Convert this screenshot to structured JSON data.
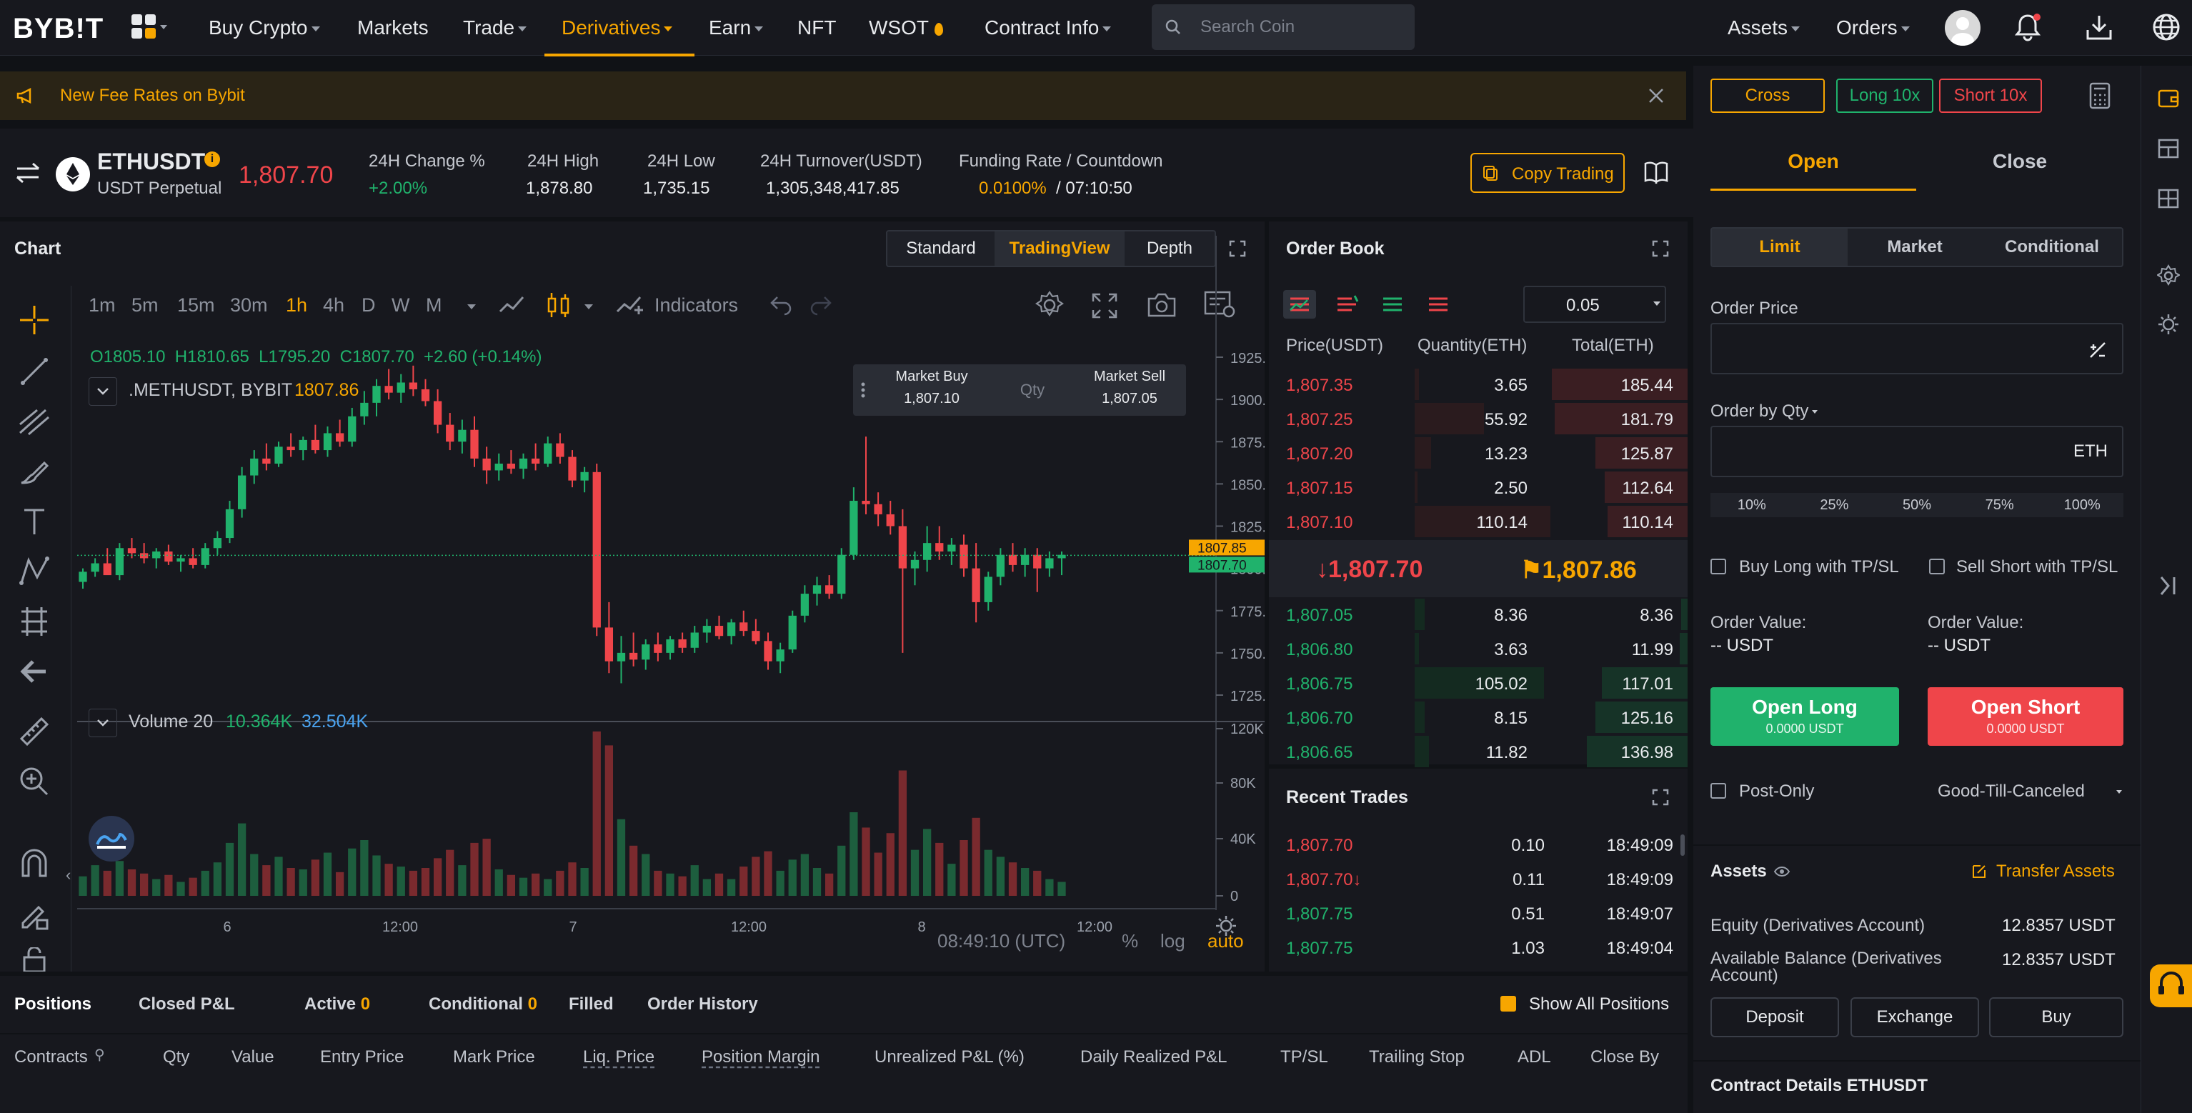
{
  "nav": {
    "logo": "BYB!T",
    "items": [
      {
        "label": "Buy Crypto",
        "caret": true
      },
      {
        "label": "Markets",
        "caret": false
      },
      {
        "label": "Trade",
        "caret": true
      },
      {
        "label": "Derivatives",
        "caret": true,
        "active": true
      },
      {
        "label": "Earn",
        "caret": true
      },
      {
        "label": "NFT",
        "caret": false
      },
      {
        "label": "WSOT",
        "caret": false
      },
      {
        "label": "Contract Info",
        "caret": true
      }
    ],
    "search_placeholder": "Search Coin",
    "assets": "Assets",
    "orders": "Orders"
  },
  "banner": {
    "text": "New Fee Rates on Bybit"
  },
  "ticker": {
    "symbol": "ETHUSDT",
    "subtitle": "USDT Perpetual",
    "price": "1,807.70",
    "change_label": "24H Change %",
    "change": "+2.00%",
    "high_label": "24H High",
    "high": "1,878.80",
    "low_label": "24H Low",
    "low": "1,735.15",
    "turnover_label": "24H Turnover(USDT)",
    "turnover": "1,305,348,417.85",
    "funding_label": "Funding Rate / Countdown",
    "funding_rate": "0.0100%",
    "countdown": "/ 07:10:50",
    "copy_trading": "Copy Trading"
  },
  "chart_panel": {
    "title": "Chart",
    "view_tabs": [
      "Standard",
      "TradingView",
      "Depth"
    ],
    "active_view": "TradingView",
    "timeframes": [
      "1m",
      "5m",
      "15m",
      "30m",
      "1h",
      "4h",
      "D",
      "W",
      "M"
    ],
    "active_timeframe": "1h",
    "indicators": "Indicators",
    "ohlc": "O1805.10  H1810.65  L1795.20  C1807.70  +2.60 (+0.14%)",
    "series_label": ".METHUSDT, BYBIT",
    "series_value": "1807.86",
    "market_buy_label": "Market Buy",
    "market_buy_price": "1,807.10",
    "qty_label": "Qty",
    "market_sell_label": "Market Sell",
    "market_sell_price": "1,807.05",
    "volume_label": "Volume 20",
    "volume_v1": "10.364K",
    "volume_v2": "32.504K",
    "time_display": "08:49:10 (UTC)",
    "scale_opts": [
      "%",
      "log",
      "auto"
    ]
  },
  "chart_data": {
    "type": "candlestick",
    "x_ticks": [
      "6",
      "12:00",
      "7",
      "12:00",
      "8",
      "12:00"
    ],
    "y_ticks": [
      "1925.00",
      "1900.00",
      "1875.00",
      "1850.00",
      "1825.00",
      "1800.00",
      "1775.00",
      "1750.00",
      "1725.00"
    ],
    "ylim": [
      1718,
      1930
    ],
    "price_labels": [
      "1807.85",
      "1807.70"
    ],
    "volume_ticks": [
      "120K",
      "80K",
      "40K",
      "0"
    ],
    "volume_ylim": [
      0,
      120
    ],
    "candles": [
      [
        1792,
        1800,
        1788,
        1798,
        14
      ],
      [
        1798,
        1806,
        1795,
        1803,
        22
      ],
      [
        1803,
        1812,
        1800,
        1796,
        18
      ],
      [
        1796,
        1815,
        1793,
        1812,
        25
      ],
      [
        1812,
        1818,
        1806,
        1809,
        19
      ],
      [
        1809,
        1815,
        1803,
        1806,
        16
      ],
      [
        1806,
        1812,
        1800,
        1810,
        12
      ],
      [
        1810,
        1814,
        1802,
        1804,
        15
      ],
      [
        1804,
        1808,
        1798,
        1806,
        10
      ],
      [
        1806,
        1812,
        1800,
        1802,
        13
      ],
      [
        1802,
        1815,
        1800,
        1812,
        18
      ],
      [
        1812,
        1822,
        1808,
        1818,
        24
      ],
      [
        1818,
        1840,
        1815,
        1835,
        38
      ],
      [
        1835,
        1860,
        1830,
        1855,
        52
      ],
      [
        1855,
        1870,
        1850,
        1865,
        30
      ],
      [
        1865,
        1874,
        1858,
        1862,
        22
      ],
      [
        1862,
        1875,
        1860,
        1872,
        28
      ],
      [
        1872,
        1880,
        1866,
        1870,
        20
      ],
      [
        1870,
        1878,
        1864,
        1876,
        19
      ],
      [
        1876,
        1885,
        1868,
        1870,
        26
      ],
      [
        1870,
        1884,
        1866,
        1880,
        31
      ],
      [
        1880,
        1888,
        1872,
        1875,
        17
      ],
      [
        1875,
        1895,
        1872,
        1890,
        34
      ],
      [
        1890,
        1905,
        1885,
        1898,
        40
      ],
      [
        1898,
        1912,
        1890,
        1908,
        29
      ],
      [
        1908,
        1918,
        1900,
        1904,
        23
      ],
      [
        1904,
        1915,
        1898,
        1910,
        21
      ],
      [
        1910,
        1920,
        1902,
        1906,
        18
      ],
      [
        1906,
        1912,
        1896,
        1899,
        20
      ],
      [
        1899,
        1906,
        1880,
        1885,
        27
      ],
      [
        1885,
        1892,
        1870,
        1875,
        33
      ],
      [
        1875,
        1888,
        1868,
        1882,
        22
      ],
      [
        1882,
        1890,
        1860,
        1865,
        38
      ],
      [
        1865,
        1872,
        1850,
        1858,
        41
      ],
      [
        1858,
        1868,
        1852,
        1862,
        19
      ],
      [
        1862,
        1870,
        1856,
        1859,
        15
      ],
      [
        1859,
        1868,
        1853,
        1865,
        13
      ],
      [
        1865,
        1874,
        1858,
        1862,
        16
      ],
      [
        1862,
        1878,
        1860,
        1874,
        12
      ],
      [
        1874,
        1880,
        1862,
        1866,
        18
      ],
      [
        1866,
        1870,
        1848,
        1852,
        24
      ],
      [
        1852,
        1860,
        1845,
        1857,
        20
      ],
      [
        1857,
        1862,
        1760,
        1765,
        118
      ],
      [
        1765,
        1780,
        1738,
        1745,
        108
      ],
      [
        1745,
        1760,
        1732,
        1750,
        55
      ],
      [
        1750,
        1762,
        1742,
        1746,
        36
      ],
      [
        1746,
        1758,
        1740,
        1755,
        30
      ],
      [
        1755,
        1762,
        1745,
        1750,
        18
      ],
      [
        1750,
        1760,
        1746,
        1758,
        16
      ],
      [
        1758,
        1762,
        1750,
        1753,
        14
      ],
      [
        1753,
        1766,
        1750,
        1762,
        22
      ],
      [
        1762,
        1770,
        1756,
        1766,
        12
      ],
      [
        1766,
        1772,
        1758,
        1760,
        16
      ],
      [
        1760,
        1770,
        1755,
        1768,
        12
      ],
      [
        1768,
        1775,
        1760,
        1763,
        21
      ],
      [
        1763,
        1770,
        1755,
        1757,
        28
      ],
      [
        1757,
        1762,
        1740,
        1745,
        32
      ],
      [
        1745,
        1756,
        1738,
        1752,
        18
      ],
      [
        1752,
        1775,
        1750,
        1772,
        26
      ],
      [
        1772,
        1790,
        1768,
        1785,
        30
      ],
      [
        1785,
        1795,
        1778,
        1790,
        20
      ],
      [
        1790,
        1796,
        1782,
        1785,
        16
      ],
      [
        1785,
        1812,
        1782,
        1808,
        36
      ],
      [
        1808,
        1848,
        1805,
        1840,
        60
      ],
      [
        1840,
        1878,
        1832,
        1838,
        49
      ],
      [
        1838,
        1845,
        1825,
        1832,
        31
      ],
      [
        1832,
        1840,
        1820,
        1825,
        45
      ],
      [
        1825,
        1835,
        1750,
        1800,
        90
      ],
      [
        1800,
        1810,
        1790,
        1805,
        33
      ],
      [
        1805,
        1825,
        1798,
        1815,
        48
      ],
      [
        1815,
        1825,
        1805,
        1810,
        38
      ],
      [
        1810,
        1818,
        1802,
        1814,
        23
      ],
      [
        1814,
        1820,
        1795,
        1800,
        40
      ],
      [
        1800,
        1815,
        1768,
        1780,
        56
      ],
      [
        1780,
        1798,
        1775,
        1795,
        33
      ],
      [
        1795,
        1812,
        1790,
        1808,
        28
      ],
      [
        1808,
        1815,
        1798,
        1802,
        24
      ],
      [
        1802,
        1812,
        1795,
        1808,
        20
      ],
      [
        1808,
        1812,
        1786,
        1800,
        18
      ],
      [
        1800,
        1810,
        1795,
        1806,
        12
      ],
      [
        1806,
        1810,
        1796,
        1808,
        10
      ]
    ]
  },
  "orderbook": {
    "title": "Order Book",
    "precision": "0.05",
    "headers": [
      "Price(USDT)",
      "Quantity(ETH)",
      "Total(ETH)"
    ],
    "asks": [
      {
        "price": "1,807.35",
        "qty": "3.65",
        "total": "185.44",
        "depth": 1.0
      },
      {
        "price": "1,807.25",
        "qty": "55.92",
        "total": "181.79",
        "depth": 0.98
      },
      {
        "price": "1,807.20",
        "qty": "13.23",
        "total": "125.87",
        "depth": 0.68
      },
      {
        "price": "1,807.15",
        "qty": "2.50",
        "total": "112.64",
        "depth": 0.61
      },
      {
        "price": "1,807.10",
        "qty": "110.14",
        "total": "110.14",
        "depth": 0.59
      }
    ],
    "last_price": "1,807.70",
    "mark_price": "1,807.86",
    "bids": [
      {
        "price": "1,807.05",
        "qty": "8.36",
        "total": "8.36",
        "depth": 0.05
      },
      {
        "price": "1,806.80",
        "qty": "3.63",
        "total": "11.99",
        "depth": 0.06
      },
      {
        "price": "1,806.75",
        "qty": "105.02",
        "total": "117.01",
        "depth": 0.63
      },
      {
        "price": "1,806.70",
        "qty": "8.15",
        "total": "125.16",
        "depth": 0.68
      },
      {
        "price": "1,806.65",
        "qty": "11.82",
        "total": "136.98",
        "depth": 0.74
      }
    ]
  },
  "recent_trades": {
    "title": "Recent Trades",
    "rows": [
      {
        "price": "1,807.70",
        "qty": "0.10",
        "time": "18:49:09",
        "side": "sell",
        "arrow": ""
      },
      {
        "price": "1,807.70",
        "qty": "0.11",
        "time": "18:49:09",
        "side": "sell",
        "arrow": "↓"
      },
      {
        "price": "1,807.75",
        "qty": "0.51",
        "time": "18:49:07",
        "side": "buy",
        "arrow": ""
      },
      {
        "price": "1,807.75",
        "qty": "1.03",
        "time": "18:49:04",
        "side": "buy",
        "arrow": ""
      }
    ]
  },
  "order_form": {
    "margin_mode": "Cross",
    "long_lev": "Long 10x",
    "short_lev": "Short 10x",
    "tabs": [
      "Open",
      "Close"
    ],
    "types": [
      "Limit",
      "Market",
      "Conditional"
    ],
    "price_label": "Order Price",
    "qty_label": "Order by Qty",
    "qty_unit": "ETH",
    "pcts": [
      "10%",
      "25%",
      "50%",
      "75%",
      "100%"
    ],
    "buy_tpsl": "Buy Long with TP/SL",
    "sell_tpsl": "Sell Short with TP/SL",
    "order_value_label": "Order Value:",
    "order_value": "-- USDT",
    "open_long": "Open Long",
    "open_long_sub": "0.0000 USDT",
    "open_short": "Open Short",
    "open_short_sub": "0.0000 USDT",
    "post_only": "Post-Only",
    "tif": "Good-Till-Canceled"
  },
  "assets": {
    "title": "Assets",
    "transfer": "Transfer Assets",
    "equity_label": "Equity (Derivatives Account)",
    "equity": "12.8357 USDT",
    "avail_label": "Available Balance (Derivatives Account)",
    "avail": "12.8357 USDT",
    "buttons": [
      "Deposit",
      "Exchange",
      "Buy"
    ],
    "contract_details": "Contract Details ETHUSDT"
  },
  "positions": {
    "tabs": [
      {
        "label": "Positions",
        "count": ""
      },
      {
        "label": "Closed P&L",
        "count": ""
      },
      {
        "label": "Active",
        "count": "0"
      },
      {
        "label": "Conditional",
        "count": "0"
      },
      {
        "label": "Filled",
        "count": ""
      },
      {
        "label": "Order History",
        "count": ""
      }
    ],
    "show_all": "Show All Positions",
    "columns": [
      "Contracts",
      "Qty",
      "Value",
      "Entry Price",
      "Mark Price",
      "Liq. Price",
      "Position Margin",
      "Unrealized P&L (%)",
      "Daily Realized P&L",
      "TP/SL",
      "Trailing Stop",
      "ADL",
      "Close By"
    ]
  },
  "colors": {
    "accent": "#f7a600",
    "green": "#20b26c",
    "red": "#ef454a",
    "panel": "#17181e",
    "bg": "#101216"
  }
}
